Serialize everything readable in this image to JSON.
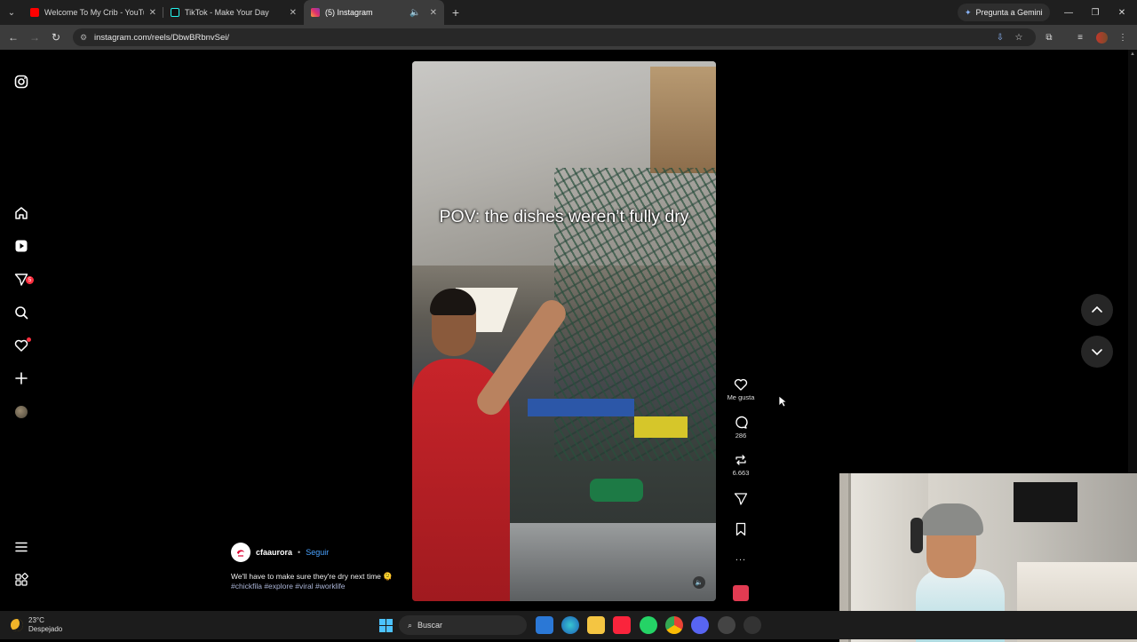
{
  "browser": {
    "tabs": [
      {
        "title": "Welcome To My Crib - YouTube",
        "favicon_color": "#ff0000",
        "active": false
      },
      {
        "title": "TikTok - Make Your Day",
        "favicon_color": "#111111",
        "active": false
      },
      {
        "title": "(5) Instagram",
        "favicon_color": "#e1306c",
        "active": true
      }
    ],
    "new_tab": "+",
    "gemini_label": "Pregunta a Gemini",
    "url": "instagram.com/reels/DbwBRbnvSei/"
  },
  "sidebar": {
    "notification_count": "5"
  },
  "reel": {
    "caption": "POV: the dishes weren’t fully dry",
    "author": "cfaaurora",
    "separator": "•",
    "follow": "Seguir",
    "description": "We'll have to make sure they're dry next time 🫠",
    "tags": "#chickfila #explore #viral #worklife"
  },
  "actions": {
    "like_label": "Me gusta",
    "comments": "286",
    "reposts": "6.663",
    "more": "..."
  },
  "taskbar": {
    "temperature": "23°C",
    "condition": "Despejado",
    "search_placeholder": "Buscar"
  },
  "colors": {
    "accent_link": "#4aa3ff",
    "badge": "#ff3040",
    "background": "#000000"
  }
}
